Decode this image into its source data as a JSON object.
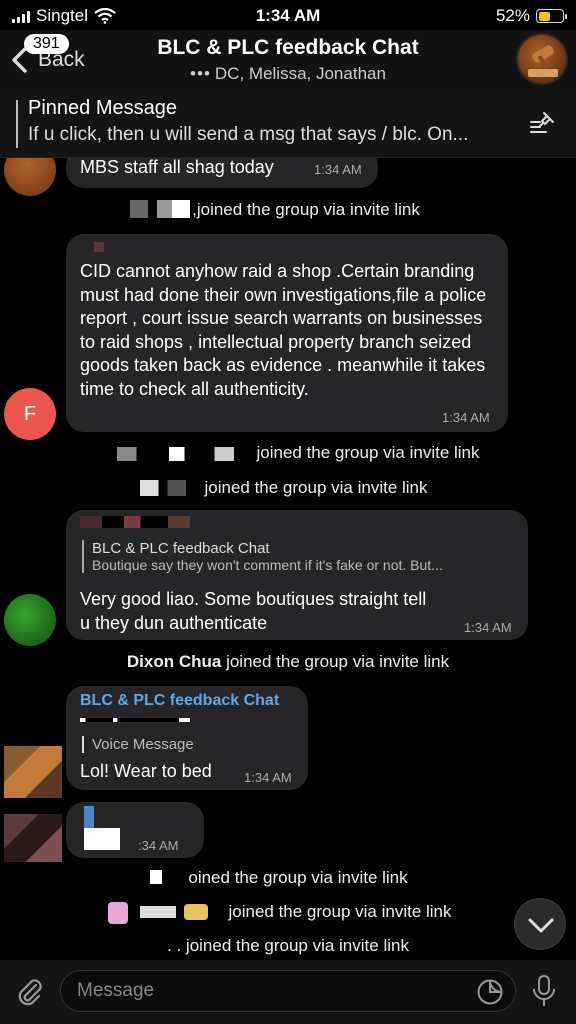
{
  "status": {
    "carrier": "Singtel",
    "time": "1:34 AM",
    "battery": "52%"
  },
  "navbar": {
    "back_label": "Back",
    "badge": "391",
    "title": "BLC & PLC feedback Chat",
    "subtitle": "DC, Melissa, Jonathan"
  },
  "pinned": {
    "title": "Pinned Message",
    "text": "If u click, then u will send a msg that says / blc. On..."
  },
  "messages": {
    "m1": {
      "text": "MBS staff all shag today",
      "time": "1:34 AM"
    },
    "sys1": {
      "text": ",joined the group via invite link"
    },
    "m2": {
      "avatar_letter": "F",
      "text": "CID cannot anyhow raid a shop .Certain branding must had done their own investigations,file a police report , court issue search warrants on businesses to raid shops , intellectual property branch seized goods taken back as evidence . meanwhile it takes time to check all authenticity.",
      "time": "1:34 AM"
    },
    "sys2": {
      "text": "joined the group via invite link"
    },
    "sys3": {
      "text": "joined the group via invite link"
    },
    "m3": {
      "reply_title": "BLC & PLC feedback Chat",
      "reply_text": "Boutique say they won't comment if it's fake or not. But...",
      "text": "Very good liao. Some boutiques straight tell u they dun authenticate",
      "time": "1:34 AM"
    },
    "sys4": {
      "name": "Dixon Chua",
      "text": "joined the group via invite link"
    },
    "m4": {
      "sender": "BLC & PLC feedback Chat",
      "reply_text": "Voice Message",
      "text": "Lol! Wear to bed",
      "time": "1:34 AM"
    },
    "m5": {
      "time": ":34 AM"
    },
    "sys5": {
      "text": "oined the group via invite link"
    },
    "sys6": {
      "text": "joined the group via invite link"
    },
    "sys7": {
      "text": ". . joined the group via invite link"
    }
  },
  "composer": {
    "placeholder": "Message"
  },
  "colors": {
    "background": "#000000",
    "bubble": "#262628",
    "accent_link": "#5fa8e8",
    "avatar_f": "#e9574f",
    "battery": "#f5c400"
  },
  "icons": [
    "back-chevron-icon",
    "pin-list-icon",
    "attach-icon",
    "sticker-icon",
    "mic-icon",
    "chevron-down-icon",
    "wifi-icon",
    "battery-icon"
  ]
}
